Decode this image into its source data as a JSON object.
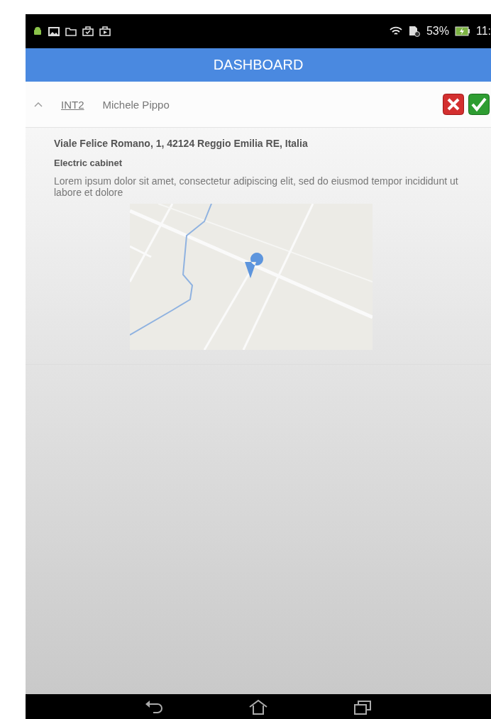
{
  "status_bar": {
    "battery": "53%",
    "time": "11:"
  },
  "app_bar": {
    "title": "DASHBOARD"
  },
  "items": [
    {
      "code": "INT2",
      "name": "Michele Pippo",
      "expanded": true,
      "address": "Viale Felice Romano, 1, 42124 Reggio Emilia RE, Italia",
      "type": "Electric cabinet",
      "description": "Lorem ipsum dolor sit amet, consectetur adipiscing elit, sed do eiusmod tempor incididunt ut labore et dolore"
    }
  ]
}
